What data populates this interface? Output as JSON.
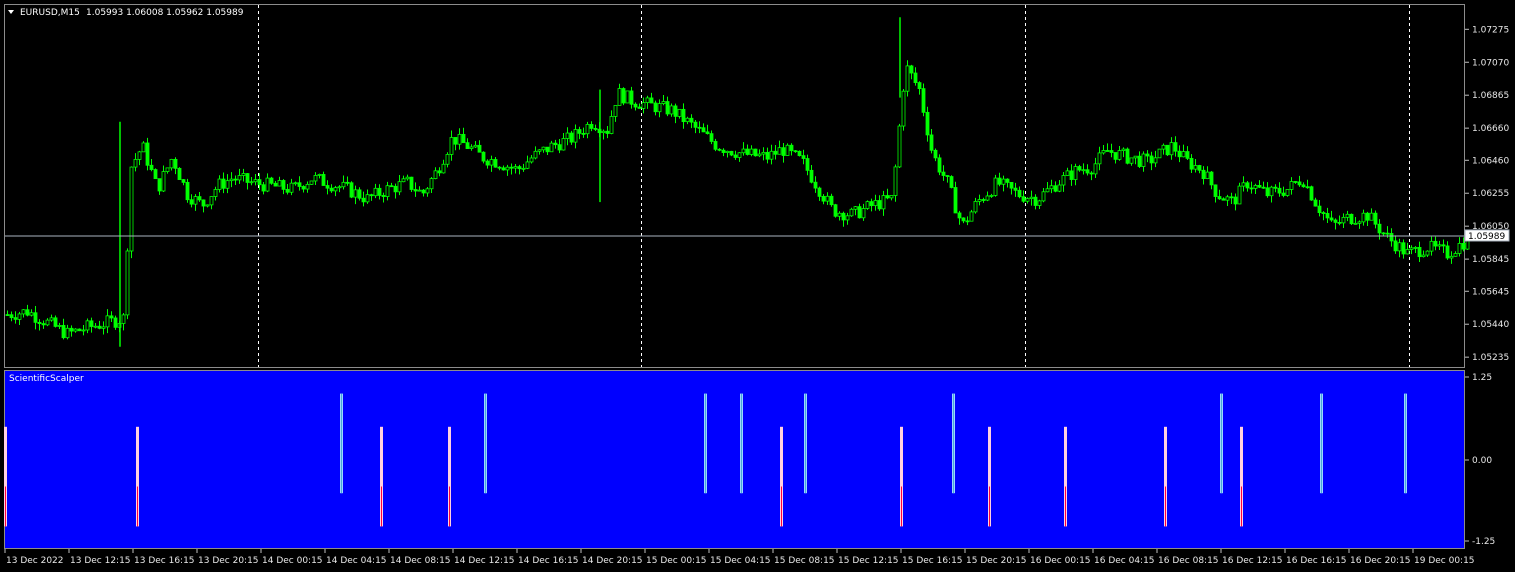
{
  "header": {
    "symbol": "EURUSD,M15",
    "ohlc": "1.05993 1.06008 1.05962 1.05989"
  },
  "indicator": {
    "name": "ScientificScalper",
    "levels": [
      "1.25",
      "0.00",
      "-1.25"
    ]
  },
  "current_price": "1.05989",
  "colors": {
    "background": "#000000",
    "candle": "#00ff00",
    "grid": "#ffffff",
    "indicator_bg": "#0000ff",
    "buy_bar": "#9ad4ff",
    "sell_bar": "#ffd0e0",
    "sell_bar_accent": "#ff0040",
    "bid_line": "#aab4c0"
  },
  "chart_data": {
    "type": "candlestick",
    "price_axis": {
      "ticks": [
        "1.07275",
        "1.07070",
        "1.06865",
        "1.06660",
        "1.06460",
        "1.06255",
        "1.06050",
        "1.05845",
        "1.05645",
        "1.05440",
        "1.05235"
      ],
      "range": [
        1.0518,
        1.0742
      ]
    },
    "time_axis": {
      "labels": [
        "13 Dec 2022",
        "13 Dec 12:15",
        "13 Dec 16:15",
        "13 Dec 20:15",
        "14 Dec 00:15",
        "14 Dec 04:15",
        "14 Dec 08:15",
        "14 Dec 12:15",
        "14 Dec 16:15",
        "14 Dec 20:15",
        "15 Dec 00:15",
        "15 Dec 04:15",
        "15 Dec 08:15",
        "15 Dec 12:15",
        "15 Dec 16:15",
        "15 Dec 20:15",
        "16 Dec 00:15",
        "16 Dec 04:15",
        "16 Dec 08:15",
        "16 Dec 12:15",
        "16 Dec 16:15",
        "16 Dec 20:15",
        "19 Dec 00:15"
      ]
    },
    "day_separators": [
      "14 Dec 00:15",
      "15 Dec 00:15",
      "16 Dec 00:15",
      "19 Dec 00:15"
    ],
    "close_path": [
      [
        0,
        1.055
      ],
      [
        20,
        1.0552
      ],
      [
        40,
        1.0545
      ],
      [
        60,
        1.0538
      ],
      [
        80,
        1.0542
      ],
      [
        100,
        1.0545
      ],
      [
        118,
        1.0548
      ],
      [
        122,
        1.064
      ],
      [
        135,
        1.0655
      ],
      [
        150,
        1.0628
      ],
      [
        165,
        1.0648
      ],
      [
        180,
        1.0625
      ],
      [
        195,
        1.0618
      ],
      [
        210,
        1.063
      ],
      [
        225,
        1.0635
      ],
      [
        245,
        1.0632
      ],
      [
        265,
        1.063
      ],
      [
        285,
        1.0628
      ],
      [
        305,
        1.0635
      ],
      [
        320,
        1.0632
      ],
      [
        340,
        1.0628
      ],
      [
        360,
        1.0622
      ],
      [
        380,
        1.0628
      ],
      [
        400,
        1.0632
      ],
      [
        415,
        1.0625
      ],
      [
        430,
        1.064
      ],
      [
        445,
        1.066
      ],
      [
        460,
        1.0655
      ],
      [
        475,
        1.0648
      ],
      [
        490,
        1.0645
      ],
      [
        510,
        1.064
      ],
      [
        525,
        1.0648
      ],
      [
        545,
        1.0655
      ],
      [
        565,
        1.066
      ],
      [
        585,
        1.067
      ],
      [
        600,
        1.0665
      ],
      [
        610,
        1.0688
      ],
      [
        625,
        1.0683
      ],
      [
        645,
        1.068
      ],
      [
        665,
        1.0677
      ],
      [
        690,
        1.0665
      ],
      [
        710,
        1.0655
      ],
      [
        735,
        1.065
      ],
      [
        760,
        1.0648
      ],
      [
        775,
        1.0653
      ],
      [
        795,
        1.0645
      ],
      [
        810,
        1.063
      ],
      [
        825,
        1.0615
      ],
      [
        845,
        1.0612
      ],
      [
        865,
        1.0618
      ],
      [
        885,
        1.0622
      ],
      [
        898,
        1.0705
      ],
      [
        912,
        1.069
      ],
      [
        925,
        1.065
      ],
      [
        940,
        1.0632
      ],
      [
        955,
        1.0605
      ],
      [
        970,
        1.062
      ],
      [
        990,
        1.0632
      ],
      [
        1010,
        1.0625
      ],
      [
        1030,
        1.0622
      ],
      [
        1050,
        1.0632
      ],
      [
        1070,
        1.064
      ],
      [
        1085,
        1.0642
      ],
      [
        1100,
        1.0652
      ],
      [
        1120,
        1.0648
      ],
      [
        1140,
        1.0645
      ],
      [
        1165,
        1.0655
      ],
      [
        1180,
        1.0645
      ],
      [
        1195,
        1.064
      ],
      [
        1210,
        1.0625
      ],
      [
        1225,
        1.062
      ],
      [
        1240,
        1.0632
      ],
      [
        1260,
        1.0625
      ],
      [
        1280,
        1.0628
      ],
      [
        1295,
        1.0635
      ],
      [
        1310,
        1.0618
      ],
      [
        1325,
        1.0605
      ],
      [
        1340,
        1.061
      ],
      [
        1360,
        1.0612
      ],
      [
        1380,
        1.0598
      ],
      [
        1400,
        1.0588
      ],
      [
        1420,
        1.0592
      ],
      [
        1440,
        1.0588
      ],
      [
        1465,
        1.0599
      ]
    ],
    "spikes": [
      [
        1.053,
        1.067
      ],
      [
        1.062,
        1.069
      ],
      [
        1.0685,
        1.0735
      ]
    ],
    "indicator_bars": [
      {
        "t": 5,
        "side": "sell"
      },
      {
        "t": 137,
        "side": "sell"
      },
      {
        "t": 341,
        "side": "buy"
      },
      {
        "t": 381,
        "side": "sell"
      },
      {
        "t": 449,
        "side": "sell"
      },
      {
        "t": 485,
        "side": "buy"
      },
      {
        "t": 705,
        "side": "buy"
      },
      {
        "t": 741,
        "side": "buy"
      },
      {
        "t": 781,
        "side": "sell"
      },
      {
        "t": 805,
        "side": "buy"
      },
      {
        "t": 901,
        "side": "sell"
      },
      {
        "t": 953,
        "side": "buy"
      },
      {
        "t": 989,
        "side": "sell"
      },
      {
        "t": 1065,
        "side": "sell"
      },
      {
        "t": 1165,
        "side": "sell"
      },
      {
        "t": 1221,
        "side": "buy"
      },
      {
        "t": 1241,
        "side": "sell"
      },
      {
        "t": 1321,
        "side": "buy"
      },
      {
        "t": 1405,
        "side": "buy"
      }
    ]
  }
}
